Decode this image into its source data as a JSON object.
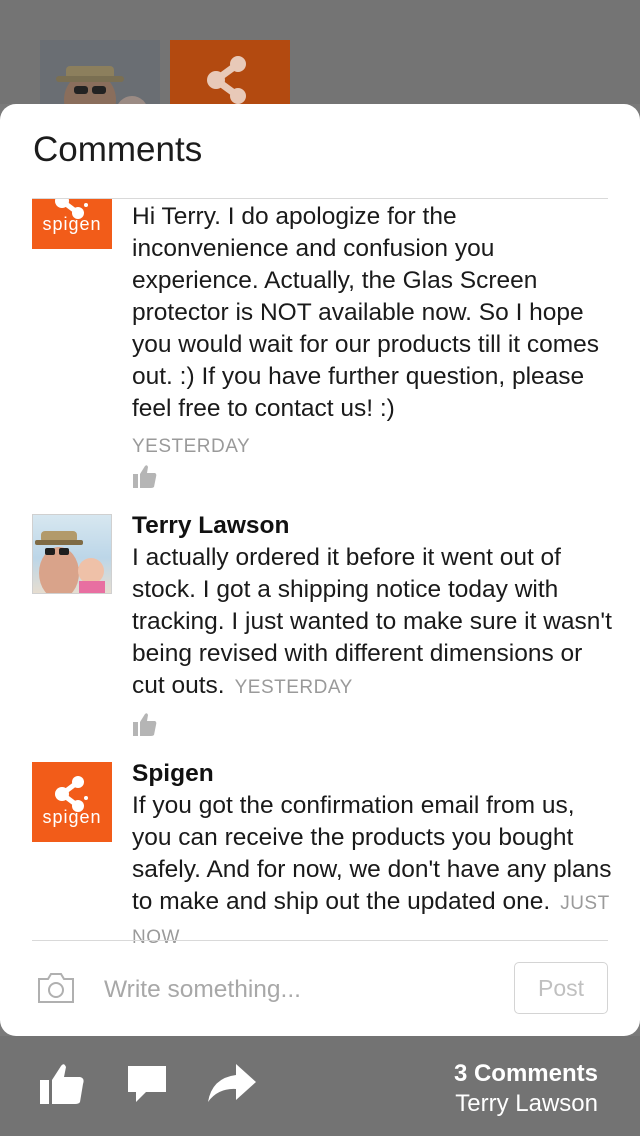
{
  "sheet": {
    "title": "Comments"
  },
  "comments": [
    {
      "author": "",
      "avatar": "spigen-logo",
      "text": "Hi Terry. I do apologize for the inconvenience and confusion you experience. Actually, the Glas Screen protector is NOT available now. So I hope you would wait for our products till it comes out. :) If you have further question, please feel free to contact us! :)",
      "time": "YESTERDAY"
    },
    {
      "author": "Terry Lawson",
      "avatar": "person-photo",
      "text": "I actually ordered it before it went out of stock. I got a shipping notice today with tracking. I just wanted to make sure it wasn't being revised with different dimensions or cut outs.",
      "time": "YESTERDAY"
    },
    {
      "author": "Spigen",
      "avatar": "spigen-logo",
      "text": "If you got the confirmation email from us, you can receive the products you bought safely. And for now, we don't have any plans to make and ship out the updated one.",
      "time": "JUST NOW"
    }
  ],
  "brand": {
    "wordmark": "spigen",
    "color": "#f25c19"
  },
  "composer": {
    "placeholder": "Write something...",
    "post_label": "Post"
  },
  "action_bar": {
    "comment_count": "3 Comments",
    "names": "Terry Lawson",
    "icons": [
      "thumbs-up-icon",
      "comment-bubble-icon",
      "share-arrow-icon"
    ]
  }
}
